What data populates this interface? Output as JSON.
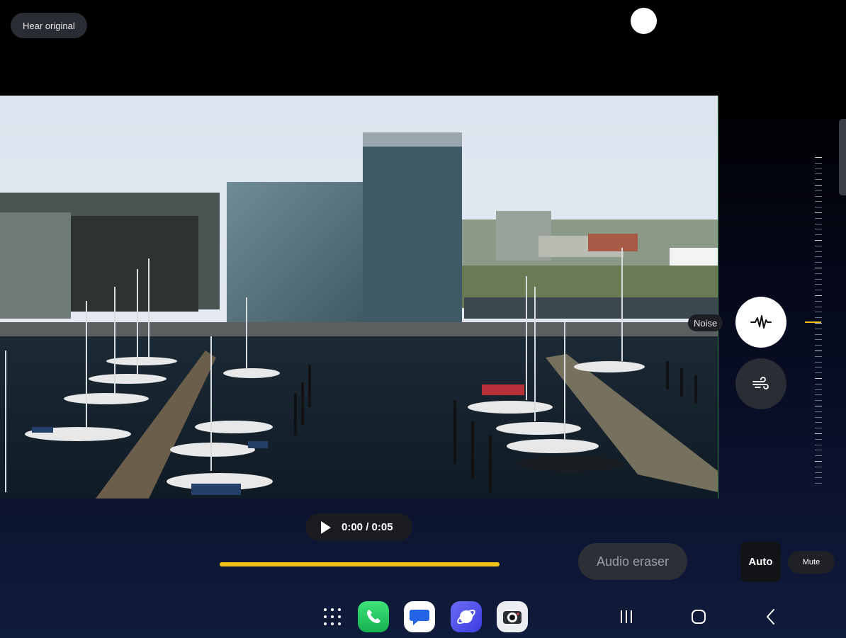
{
  "header": {
    "hear_original_label": "Hear original"
  },
  "video_preview": {
    "description_icon": "harbor-video-frame-image"
  },
  "audio_tools": {
    "noise_label": "Noise",
    "noise_icon": "sound-wave-icon",
    "wind_icon": "wind-icon"
  },
  "playback": {
    "time_text": "0:00 / 0:05",
    "progress_fraction": 1.0,
    "accent_color": "#f2c21b"
  },
  "actions": {
    "audio_eraser_label": "Audio eraser",
    "auto_label": "Auto",
    "mute_label": "Mute"
  },
  "dock": {
    "apps": [
      {
        "name": "apps-grid-icon"
      },
      {
        "name": "phone-app-icon"
      },
      {
        "name": "messages-app-icon"
      },
      {
        "name": "internet-app-icon"
      },
      {
        "name": "camera-app-icon"
      }
    ]
  },
  "nav": {
    "recent_icon": "recent-apps-icon",
    "home_icon": "home-icon",
    "back_icon": "back-icon"
  }
}
